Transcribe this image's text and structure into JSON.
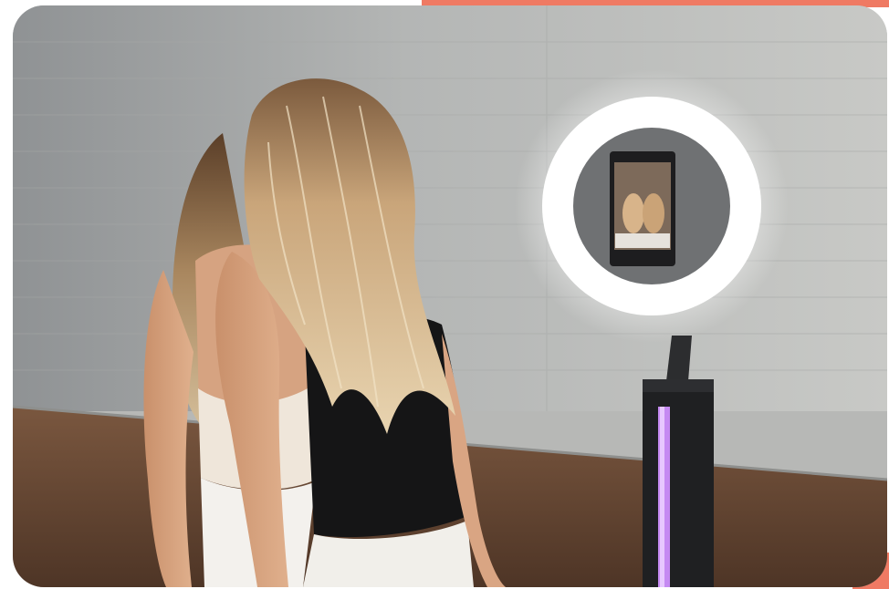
{
  "image": {
    "description_icon": "photo",
    "colors": {
      "accent": "#ef7a63",
      "wall": "#b9bab8",
      "floor": "#6b4a35",
      "ring_light": "#ffffff",
      "led_strip": "#c77dff"
    }
  }
}
